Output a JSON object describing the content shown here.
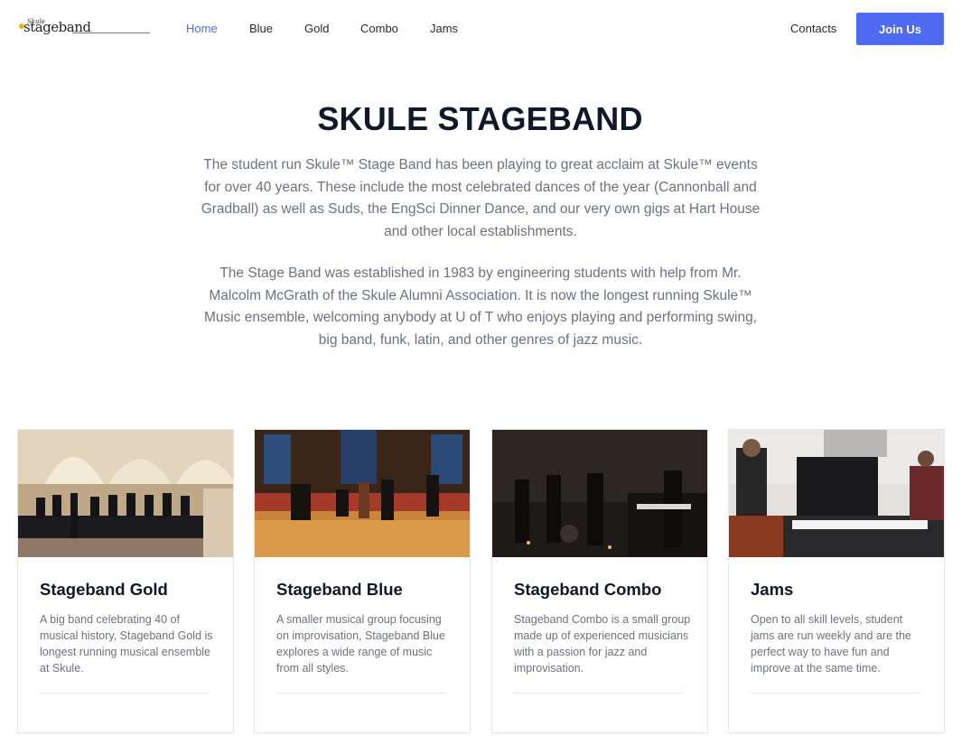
{
  "brand": {
    "logo_text": "stageband",
    "logo_small": "Skule"
  },
  "nav": {
    "links": [
      {
        "label": "Home",
        "active": true
      },
      {
        "label": "Blue",
        "active": false
      },
      {
        "label": "Gold",
        "active": false
      },
      {
        "label": "Combo",
        "active": false
      },
      {
        "label": "Jams",
        "active": false
      }
    ],
    "contacts_label": "Contacts",
    "join_label": "Join Us"
  },
  "hero": {
    "title": "SKULE STAGEBAND",
    "paragraph1": "The student run Skule™ Stage Band has been playing to great acclaim at Skule™ events for over 40 years. These include the most celebrated dances of the year (Cannonball and Gradball) as well as Suds, the EngSci Dinner Dance, and our very own gigs at Hart House and other local establishments.",
    "paragraph2": "The Stage Band was established in 1983 by engineering students with help from Mr. Malcolm McGrath of the Skule Alumni Association. It is now the longest running Skule™ Music ensemble, welcoming anybody at U of T who enjoys playing and performing swing, big band, funk, latin, and other genres of jazz music."
  },
  "cards": [
    {
      "title": "Stageband Gold",
      "text": "A big band celebrating 40 of musical history, Stageband Gold is longest running musical ensemble at Skule."
    },
    {
      "title": "Stageband Blue",
      "text": "A smaller musical group focusing on improvisation, Stageband Blue explores a wide range of music from all styles."
    },
    {
      "title": "Stageband Combo",
      "text": "Stageband Combo is a small group made up of experienced musicians with a passion for jazz and improvisation."
    },
    {
      "title": "Jams",
      "text": "Open to all skill levels, student jams are run weekly and are the perfect way to have fun and improve at the same time."
    }
  ],
  "colors": {
    "accent": "#4f6bf2",
    "active_link": "#4f6bed",
    "body_text": "#6b7280",
    "heading": "#111827"
  }
}
